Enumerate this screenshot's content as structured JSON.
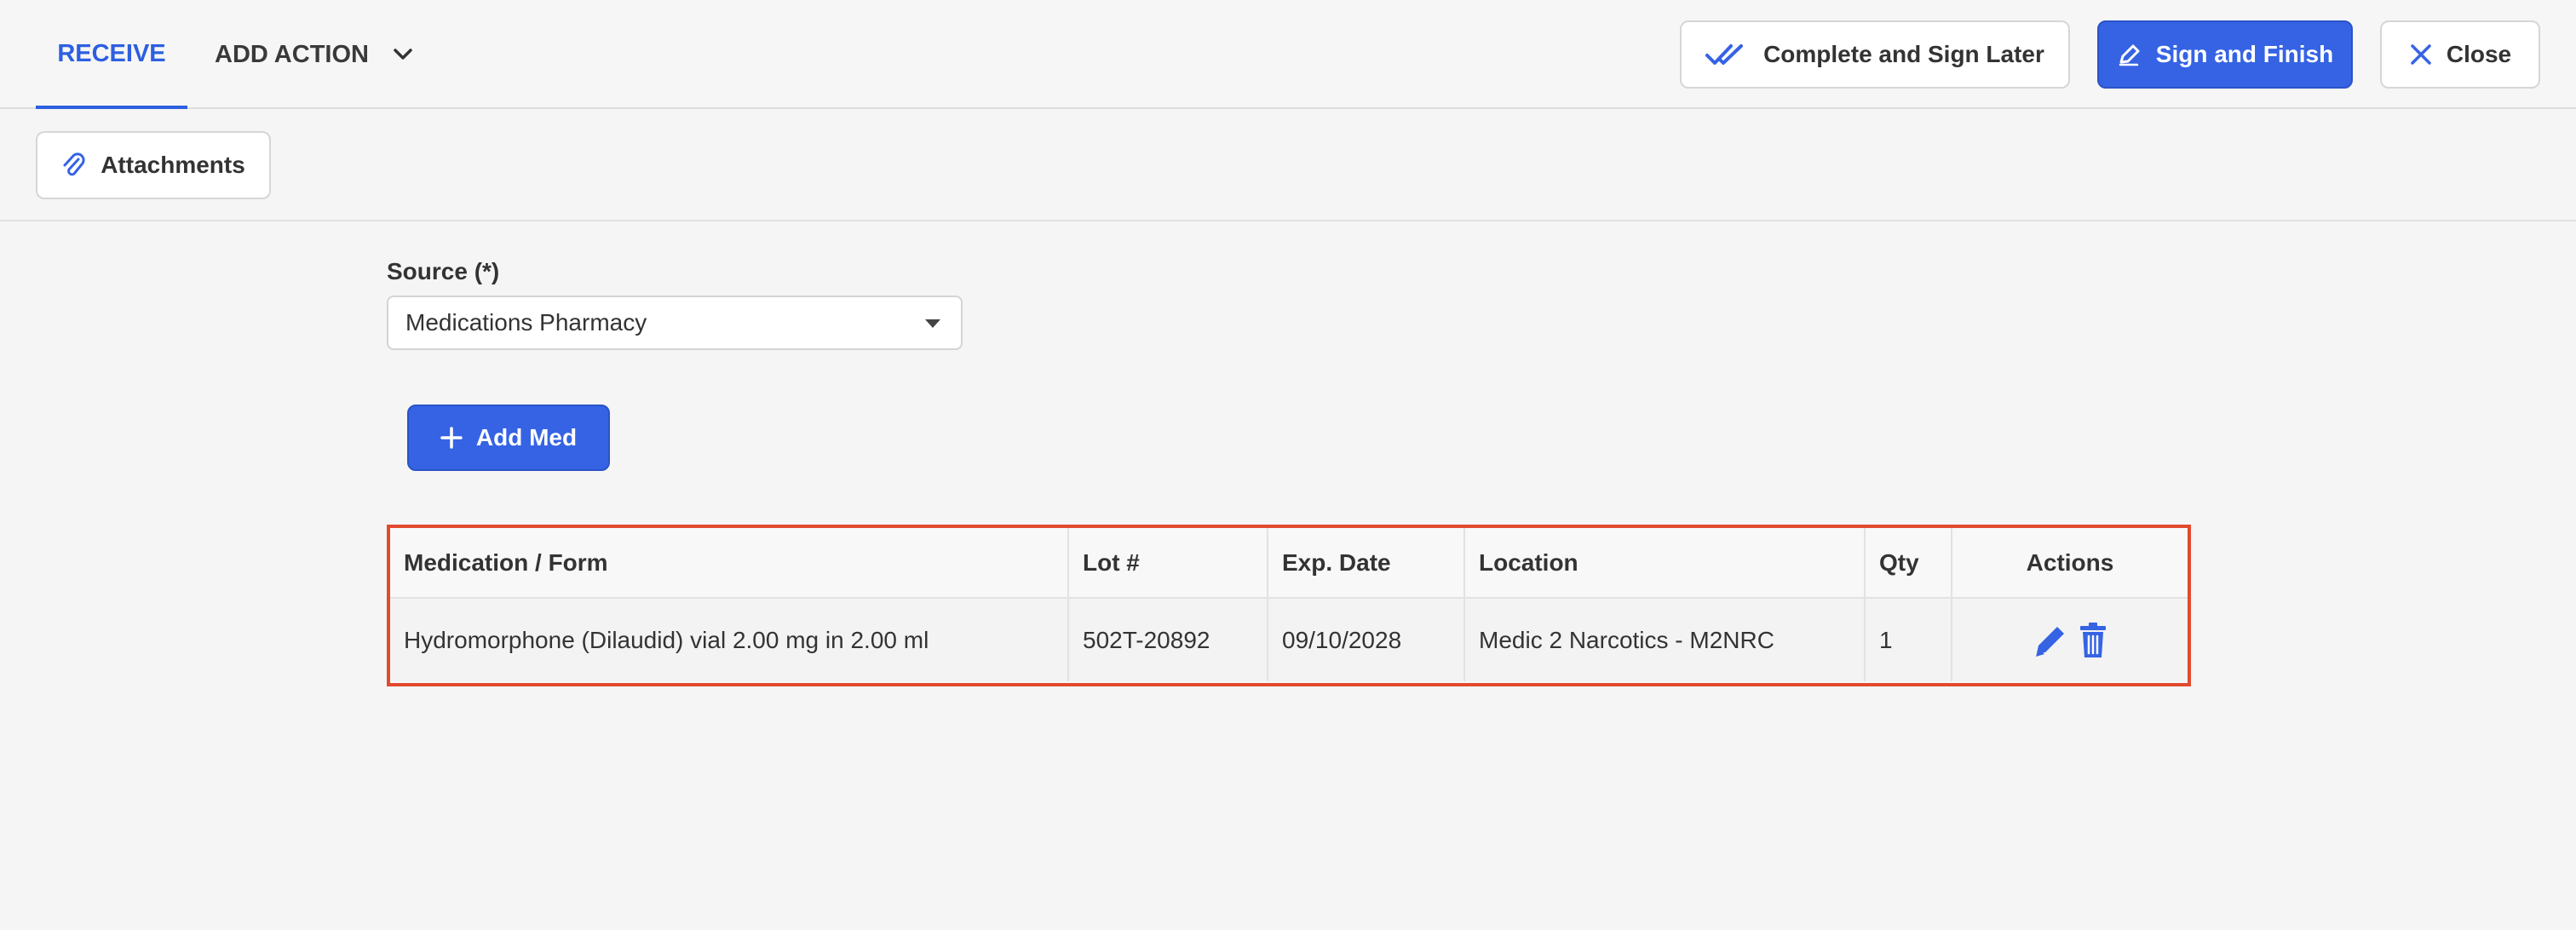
{
  "header": {
    "active_tab": "RECEIVE",
    "add_action_label": "ADD ACTION",
    "complete_later_label": "Complete and Sign Later",
    "sign_finish_label": "Sign and Finish",
    "close_label": "Close"
  },
  "toolbar": {
    "attachments_label": "Attachments"
  },
  "form": {
    "source_label": "Source (*)",
    "source_value": "Medications Pharmacy",
    "add_med_label": "Add Med"
  },
  "table": {
    "columns": [
      "Medication / Form",
      "Lot #",
      "Exp. Date",
      "Location",
      "Qty",
      "Actions"
    ],
    "rows": [
      {
        "medication": "Hydromorphone (Dilaudid) vial 2.00 mg in 2.00 ml",
        "lot": "502T-20892",
        "exp_date": "09/10/2028",
        "location": "Medic 2 Narcotics - M2NRC",
        "qty": "1",
        "actions": [
          "edit-icon",
          "trash-icon"
        ]
      }
    ]
  },
  "colors": {
    "accent": "#3563e4",
    "highlight_border": "#e24a2f",
    "background": "#f5f5f5"
  }
}
